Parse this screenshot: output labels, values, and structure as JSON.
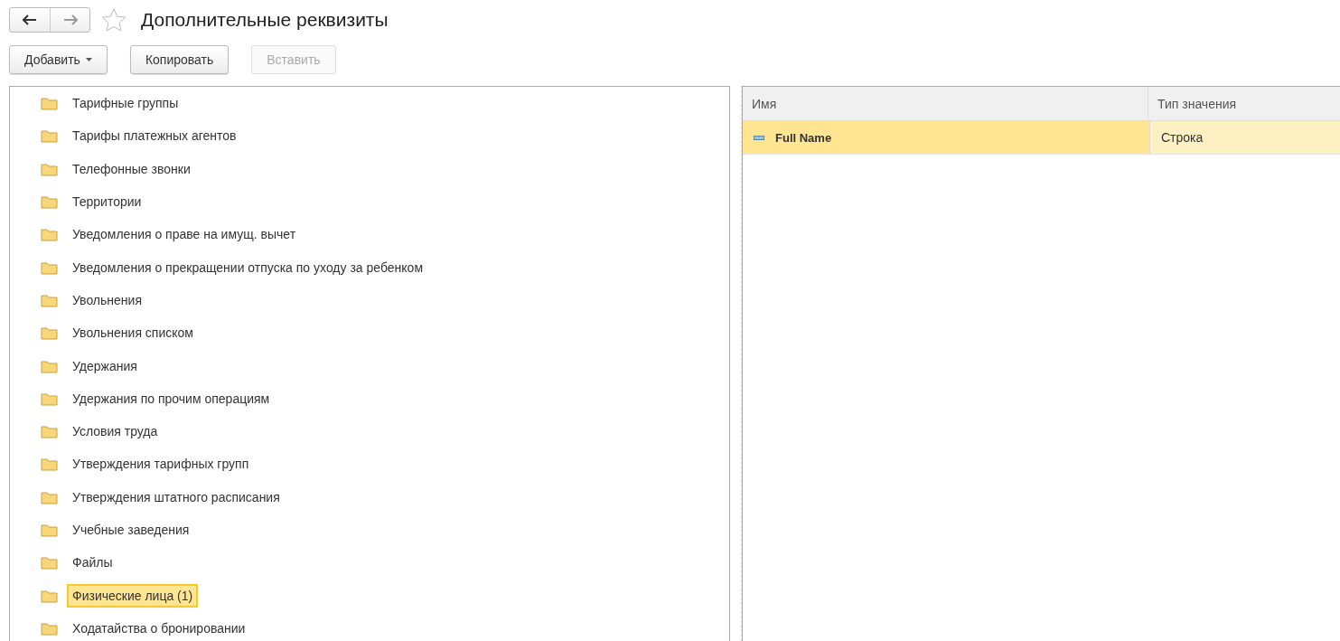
{
  "window": {
    "title": "Дополнительные реквизиты",
    "favorite": false
  },
  "toolbar": {
    "buttons": [
      {
        "label": "Добавить",
        "dropdown": true,
        "disabled": false
      },
      {
        "label": "Копировать",
        "dropdown": false,
        "disabled": false
      },
      {
        "label": "Вставить",
        "dropdown": false,
        "disabled": true
      }
    ]
  },
  "tree": {
    "items": [
      {
        "label": "Тарифные группы",
        "selected": false
      },
      {
        "label": "Тарифы платежных агентов",
        "selected": false
      },
      {
        "label": "Телефонные звонки",
        "selected": false
      },
      {
        "label": "Территории",
        "selected": false
      },
      {
        "label": "Уведомления о праве на имущ. вычет",
        "selected": false
      },
      {
        "label": "Уведомления о прекращении отпуска по уходу за ребенком",
        "selected": false
      },
      {
        "label": "Увольнения",
        "selected": false
      },
      {
        "label": "Увольнения списком",
        "selected": false
      },
      {
        "label": "Удержания",
        "selected": false
      },
      {
        "label": "Удержания по прочим операциям",
        "selected": false
      },
      {
        "label": "Условия труда",
        "selected": false
      },
      {
        "label": "Утверждения тарифных групп",
        "selected": false
      },
      {
        "label": "Утверждения штатного расписания",
        "selected": false
      },
      {
        "label": "Учебные заведения",
        "selected": false
      },
      {
        "label": "Файлы",
        "selected": false
      },
      {
        "label": "Физические лица (1)",
        "selected": true
      },
      {
        "label": "Ходатайства о бронировании",
        "selected": false
      }
    ]
  },
  "table": {
    "columns": [
      "Имя",
      "Тип значения"
    ],
    "rows": [
      {
        "name": "Full Name",
        "type": "Строка",
        "selected": true
      }
    ]
  }
}
